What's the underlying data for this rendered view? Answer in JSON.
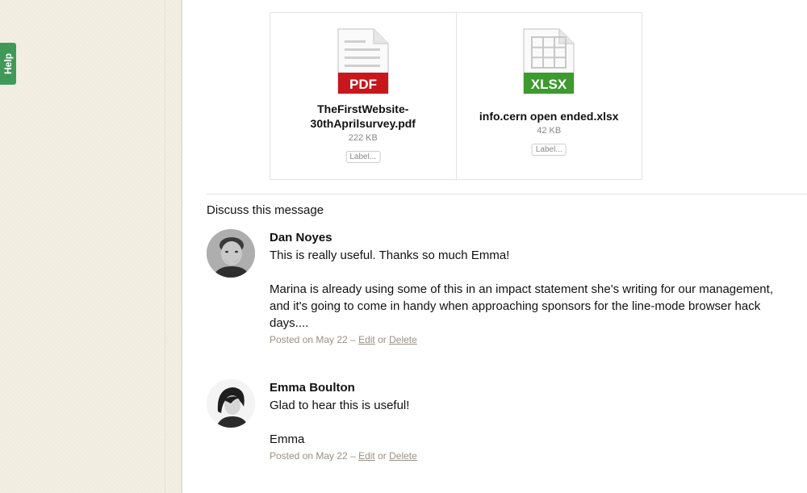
{
  "help_tab": {
    "label": "Help"
  },
  "attachments": [
    {
      "type_label": "PDF",
      "name": "TheFirstWebsite-30thAprilsurvey.pdf",
      "size": "222 KB",
      "label_button": "Label...",
      "icon": "pdf-file-icon",
      "color": "#c8161d"
    },
    {
      "type_label": "XLSX",
      "name": "info.cern open ended.xlsx",
      "size": "42 KB",
      "label_button": "Label...",
      "icon": "xlsx-file-icon",
      "color": "#3d9a2e"
    }
  ],
  "discussion": {
    "heading": "Discuss this message",
    "comments": [
      {
        "author": "Dan Noyes",
        "paragraphs": [
          "This is really useful. Thanks so much Emma!",
          "Marina is already using some of this in an impact statement she's writing for our management, and it's going to come in handy when approaching sponsors for the line-mode browser hack days...."
        ],
        "posted": "Posted on May 22 – ",
        "edit": "Edit",
        "or": " or ",
        "delete": "Delete"
      },
      {
        "author": "Emma Boulton",
        "paragraphs": [
          "Glad to hear this is useful!",
          "Emma"
        ],
        "posted": "Posted on May 22 – ",
        "edit": "Edit",
        "or": " or ",
        "delete": "Delete"
      }
    ]
  },
  "colors": {
    "background": "#f3efe3",
    "help_tab": "#3f9a5a",
    "link": "#999085"
  }
}
